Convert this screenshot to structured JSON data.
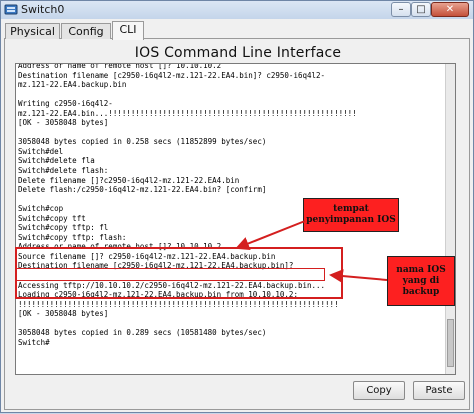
{
  "window": {
    "title": "Switch0",
    "controls": {
      "minimize": "–",
      "maximize": "□",
      "close": "✕"
    }
  },
  "tabs": [
    {
      "label": "Physical"
    },
    {
      "label": "Config"
    },
    {
      "label": "CLI",
      "active": true
    }
  ],
  "cli": {
    "heading": "IOS Command Line Interface",
    "lines": [
      "Address or name of remote host []? 10.10.10.2",
      "Destination filename [c2950-i6q4l2-mz.121-22.EA4.bin]? c2950-i6q4l2-",
      "mz.121-22.EA4.backup.bin",
      "",
      "Writing c2950-i6q4l2-",
      "mz.121-22.EA4.bin...!!!!!!!!!!!!!!!!!!!!!!!!!!!!!!!!!!!!!!!!!!!!!!!!!!!!!!!",
      "[OK - 3058048 bytes]",
      "",
      "3058048 bytes copied in 0.258 secs (11852899 bytes/sec)",
      "Switch#del",
      "Switch#delete fla",
      "Switch#delete flash:",
      "Delete filename []?c2950-i6q4l2-mz.121-22.EA4.bin",
      "Delete flash:/c2950-i6q4l2-mz.121-22.EA4.bin? [confirm]",
      "",
      "Switch#cop",
      "Switch#copy tft",
      "Switch#copy tftp: fl",
      "Switch#copy tftp: flash:",
      "Address or name of remote host []? 10.10.10.2",
      "Source filename []? c2950-i6q4l2-mz.121-22.EA4.backup.bin",
      "Destination filename [c2950-i6q4l2-mz.121-22.EA4.backup.bin]?",
      "",
      "Accessing tftp://10.10.10.2/c2950-i6q4l2-mz.121-22.EA4.backup.bin...",
      "Loading c2950-i6q4l2-mz.121-22.EA4.backup.bin from 10.10.10.2:",
      "!!!!!!!!!!!!!!!!!!!!!!!!!!!!!!!!!!!!!!!!!!!!!!!!!!!!!!!!!!!!!!!!!!!!!!!",
      "[OK - 3058048 bytes]",
      "",
      "3058048 bytes copied in 0.289 secs (10581480 bytes/sec)",
      "Switch#"
    ]
  },
  "annotations": {
    "callout_storage": "tempat\npenyimpanan IOS",
    "callout_ios_name": "nama IOS\nyang di\nbackup"
  },
  "buttons": {
    "copy": "Copy",
    "paste": "Paste"
  },
  "colors": {
    "annotation_red": "#fd2020",
    "box_red": "#d41f1f"
  }
}
